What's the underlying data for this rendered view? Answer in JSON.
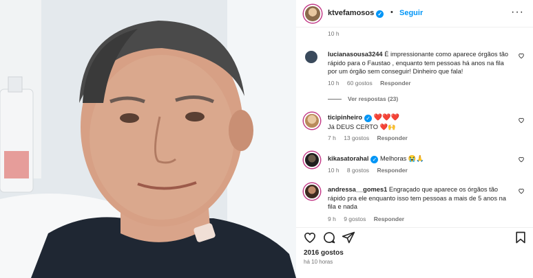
{
  "header": {
    "username": "ktvefamosos",
    "separator": "•",
    "follow_label": "Seguir",
    "more_label": "···"
  },
  "comments_top_time": "10 h",
  "comments": [
    {
      "username": "lucianasousa3244",
      "text": "É impressionante como aparece órgãos tão rápido para o Faustao , enquanto tem pessoas há anos na fila por um órgão sem conseguir! Dinheiro que fala!",
      "time": "10 h",
      "likes": "60 gostos",
      "reply": "Responder",
      "avatar_color": "#3a4a5c"
    },
    {
      "username": "ticipinheiro",
      "verified": true,
      "text": "❤️❤️❤️",
      "text2": "Já DEUS CERTO ❤️🙌",
      "time": "7 h",
      "likes": "13 gostos",
      "reply": "Responder",
      "avatar_color": "#c8a070"
    },
    {
      "username": "kikasatorahal",
      "verified": true,
      "text": "Melhoras 😭🙏",
      "time": "10 h",
      "likes": "8 gostos",
      "reply": "Responder",
      "avatar_color": "#2b2b2b"
    },
    {
      "username": "andressa__gomes1",
      "text": "Engraçado que aparece os órgãos tão rápido pra ele enquanto isso tem pessoas a mais de 5 anos na fila e nada",
      "time": "9 h",
      "likes": "9 gostos",
      "reply": "Responder",
      "avatar_color": "#5a3a2a"
    }
  ],
  "view_replies": "Ver respostas (23)",
  "footer": {
    "likes": "2016 gostos",
    "ago": "há 10 horas"
  },
  "colors": {
    "accent": "#0095f6",
    "ring": "#c13584",
    "like": "#ed4956"
  }
}
